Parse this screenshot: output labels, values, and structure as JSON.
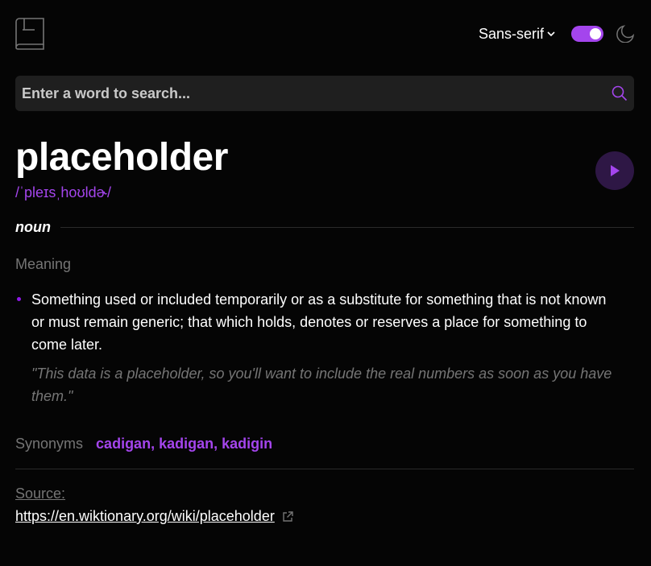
{
  "header": {
    "logo_icon": "book-icon",
    "font_selector": {
      "selected": "Sans-serif",
      "icon": "chevron-down-icon"
    },
    "theme_toggle": {
      "on": true
    },
    "theme_icon": "moon-icon",
    "accent_color": "#a445ed"
  },
  "search": {
    "placeholder": "Enter a word to search...",
    "value": "",
    "icon": "search-icon"
  },
  "entry": {
    "word": "placeholder",
    "phonetic": "/ˈpleɪsˌhoʊldɚ/",
    "play_icon": "play-icon",
    "part_of_speech": "noun",
    "meaning_heading": "Meaning",
    "definitions": [
      {
        "text": "Something used or included temporarily or as a substitute for something that is not known or must remain generic; that which holds, denotes or reserves a place for something to come later.",
        "example": "\"This data is a placeholder, so you'll want to include the real numbers as soon as you have them.\""
      }
    ],
    "synonyms_label": "Synonyms",
    "synonyms": "cadigan, kadigan, kadigin"
  },
  "source": {
    "label": "Source:",
    "url": "https://en.wiktionary.org/wiki/placeholder",
    "icon": "external-link-icon"
  }
}
